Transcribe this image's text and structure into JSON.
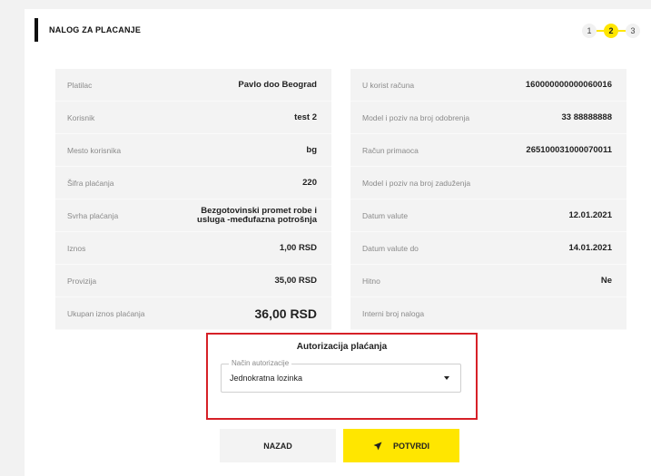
{
  "header": {
    "title": "NALOG ZA PLACANJE"
  },
  "stepper": {
    "steps": [
      "1",
      "2",
      "3"
    ],
    "active": "2"
  },
  "left_panel": [
    {
      "label": "Platilac",
      "value": "Pavlo doo Beograd"
    },
    {
      "label": "Korisnik",
      "value": "test 2"
    },
    {
      "label": "Mesto korisnika",
      "value": "bg"
    },
    {
      "label": "Šifra plaćanja",
      "value": "220"
    },
    {
      "label": "Svrha plaćanja",
      "value_line1": "Bezgotovinski promet robe i",
      "value_line2": "usluga -međufazna potrošnja"
    },
    {
      "label": "Iznos",
      "value": "1,00 RSD"
    },
    {
      "label": "Provizija",
      "value": "35,00 RSD"
    },
    {
      "label": "Ukupan iznos plaćanja",
      "value": "36,00 RSD"
    }
  ],
  "right_panel": [
    {
      "label": "U korist računa",
      "value": "160000000000060016"
    },
    {
      "label": "Model i poziv na broj odobrenja",
      "value": "33 88888888"
    },
    {
      "label": "Račun primaoca",
      "value": "265100031000070011"
    },
    {
      "label": "Model i poziv na broj zaduženja",
      "value": ""
    },
    {
      "label": "Datum valute",
      "value": "12.01.2021"
    },
    {
      "label": "Datum valute do",
      "value": "14.01.2021"
    },
    {
      "label": "Hitno",
      "value": "Ne"
    },
    {
      "label": "Interni broj naloga",
      "value": ""
    }
  ],
  "authorization": {
    "title": "Autorizacija plaćanja",
    "field_label": "Način autorizacije",
    "selected": "Jednokratna lozinka"
  },
  "buttons": {
    "back": "NAZAD",
    "confirm": "POTVRDI"
  },
  "colors": {
    "accent": "#ffe600",
    "highlight_border": "#d62027"
  }
}
